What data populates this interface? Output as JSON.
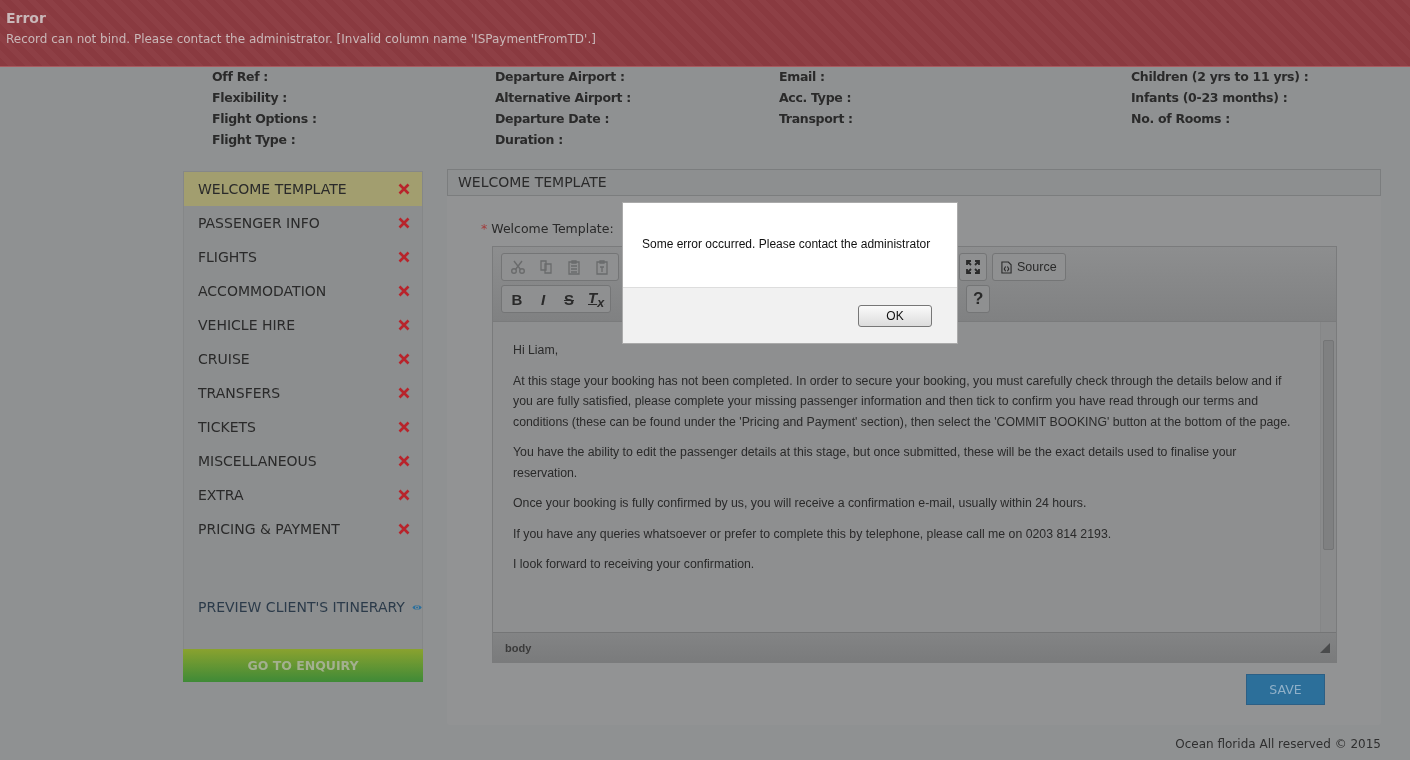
{
  "error_banner": {
    "title": "Error",
    "message": "Record can not bind. Please contact the administrator. [Invalid column name 'ISPaymentFromTD'.]"
  },
  "summary_columns": [
    [
      "Off Ref :",
      "Flexibility :",
      "Flight Options :",
      "Flight Type :"
    ],
    [
      "Departure Airport :",
      "Alternative Airport :",
      "Departure Date :",
      "Duration :"
    ],
    [
      "Email :",
      "Acc. Type :",
      "Transport :"
    ],
    [
      "Children (2 yrs to 11 yrs) :",
      "Infants (0-23 months) :",
      "No. of Rooms :"
    ]
  ],
  "sidebar": {
    "items": [
      {
        "label": "WELCOME TEMPLATE",
        "selected": true
      },
      {
        "label": "PASSENGER INFO",
        "selected": false
      },
      {
        "label": "FLIGHTS",
        "selected": false
      },
      {
        "label": "ACCOMMODATION",
        "selected": false
      },
      {
        "label": "VEHICLE HIRE",
        "selected": false
      },
      {
        "label": "CRUISE",
        "selected": false
      },
      {
        "label": "TRANSFERS",
        "selected": false
      },
      {
        "label": "TICKETS",
        "selected": false
      },
      {
        "label": "MISCELLANEOUS",
        "selected": false
      },
      {
        "label": "EXTRA",
        "selected": false
      },
      {
        "label": "PRICING & PAYMENT",
        "selected": false
      }
    ],
    "preview_link": "PREVIEW CLIENT'S ITINERARY",
    "enquiry_button": "GO TO ENQUIRY"
  },
  "panel": {
    "title": "WELCOME TEMPLATE",
    "required_mark": "*",
    "field_label": "Welcome Template:",
    "editor": {
      "format_buttons": [
        {
          "label": "B",
          "kind": "bold"
        },
        {
          "label": "I",
          "kind": "italic"
        },
        {
          "label": "S",
          "kind": "strike"
        },
        {
          "label": "T$_{x}$",
          "kind": "clear"
        }
      ],
      "source_button": "Source",
      "help_button": "?",
      "paragraphs": [
        "Hi Liam,",
        "At this stage your booking has not been completed. In order to secure your booking, you must carefully check through the details below and if you are fully satisfied, please complete your missing passenger information and then tick to confirm you have read through our terms and conditions (these can be found under the 'Pricing and Payment' section), then select the 'COMMIT BOOKING' button at the bottom of the page.",
        "You have the ability to edit the passenger details at this stage, but once submitted, these will be the exact details used to finalise your reservation.",
        "Once your booking is fully confirmed by us, you will receive a confirmation e-mail, usually within 24 hours.",
        "If you have any queries whatsoever or prefer to complete this by telephone, please call me on 0203 814 2193.",
        "I look forward to receiving your confirmation."
      ],
      "path": "body"
    },
    "save_button": "SAVE"
  },
  "footer": "Ocean florida All reserved © 2015",
  "dialog": {
    "message": "Some error occurred. Please contact the administrator",
    "ok_button": "OK"
  }
}
